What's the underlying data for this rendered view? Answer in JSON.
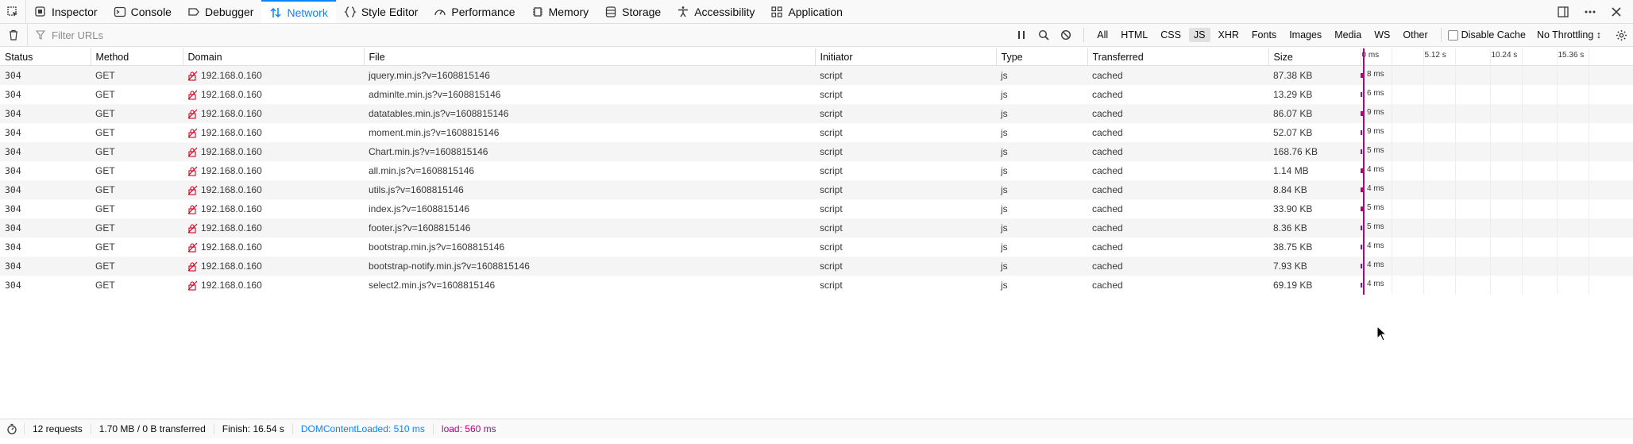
{
  "tabs": [
    {
      "label": "Inspector",
      "icon": "inspector-icon"
    },
    {
      "label": "Console",
      "icon": "console-icon"
    },
    {
      "label": "Debugger",
      "icon": "debugger-icon"
    },
    {
      "label": "Network",
      "icon": "network-icon",
      "selected": true
    },
    {
      "label": "Style Editor",
      "icon": "style-editor-icon"
    },
    {
      "label": "Performance",
      "icon": "performance-icon"
    },
    {
      "label": "Memory",
      "icon": "memory-icon"
    },
    {
      "label": "Storage",
      "icon": "storage-icon"
    },
    {
      "label": "Accessibility",
      "icon": "accessibility-icon"
    },
    {
      "label": "Application",
      "icon": "application-icon"
    }
  ],
  "filter": {
    "placeholder": "Filter URLs"
  },
  "type_filters": [
    "All",
    "HTML",
    "CSS",
    "JS",
    "XHR",
    "Fonts",
    "Images",
    "Media",
    "WS",
    "Other"
  ],
  "selected_type": "JS",
  "disable_cache_label": "Disable Cache",
  "throttling": "No Throttling ↕",
  "columns": [
    "Status",
    "Method",
    "Domain",
    "File",
    "Initiator",
    "Type",
    "Transferred",
    "Size"
  ],
  "waterfall_markers": [
    "0 ms",
    "5.12 s",
    "10.24 s",
    "15.36 s"
  ],
  "rows": [
    {
      "status": "304",
      "method": "GET",
      "domain": "192.168.0.160",
      "file": "jquery.min.js?v=1608815146",
      "initiator": "script",
      "type": "js",
      "transferred": "cached",
      "size": "87.38 KB",
      "time": "8 ms"
    },
    {
      "status": "304",
      "method": "GET",
      "domain": "192.168.0.160",
      "file": "adminlte.min.js?v=1608815146",
      "initiator": "script",
      "type": "js",
      "transferred": "cached",
      "size": "13.29 KB",
      "time": "6 ms"
    },
    {
      "status": "304",
      "method": "GET",
      "domain": "192.168.0.160",
      "file": "datatables.min.js?v=1608815146",
      "initiator": "script",
      "type": "js",
      "transferred": "cached",
      "size": "86.07 KB",
      "time": "9 ms"
    },
    {
      "status": "304",
      "method": "GET",
      "domain": "192.168.0.160",
      "file": "moment.min.js?v=1608815146",
      "initiator": "script",
      "type": "js",
      "transferred": "cached",
      "size": "52.07 KB",
      "time": "9 ms"
    },
    {
      "status": "304",
      "method": "GET",
      "domain": "192.168.0.160",
      "file": "Chart.min.js?v=1608815146",
      "initiator": "script",
      "type": "js",
      "transferred": "cached",
      "size": "168.76 KB",
      "time": "5 ms"
    },
    {
      "status": "304",
      "method": "GET",
      "domain": "192.168.0.160",
      "file": "all.min.js?v=1608815146",
      "initiator": "script",
      "type": "js",
      "transferred": "cached",
      "size": "1.14 MB",
      "time": "4 ms"
    },
    {
      "status": "304",
      "method": "GET",
      "domain": "192.168.0.160",
      "file": "utils.js?v=1608815146",
      "initiator": "script",
      "type": "js",
      "transferred": "cached",
      "size": "8.84 KB",
      "time": "4 ms"
    },
    {
      "status": "304",
      "method": "GET",
      "domain": "192.168.0.160",
      "file": "index.js?v=1608815146",
      "initiator": "script",
      "type": "js",
      "transferred": "cached",
      "size": "33.90 KB",
      "time": "5 ms"
    },
    {
      "status": "304",
      "method": "GET",
      "domain": "192.168.0.160",
      "file": "footer.js?v=1608815146",
      "initiator": "script",
      "type": "js",
      "transferred": "cached",
      "size": "8.36 KB",
      "time": "5 ms"
    },
    {
      "status": "304",
      "method": "GET",
      "domain": "192.168.0.160",
      "file": "bootstrap.min.js?v=1608815146",
      "initiator": "script",
      "type": "js",
      "transferred": "cached",
      "size": "38.75 KB",
      "time": "4 ms"
    },
    {
      "status": "304",
      "method": "GET",
      "domain": "192.168.0.160",
      "file": "bootstrap-notify.min.js?v=1608815146",
      "initiator": "script",
      "type": "js",
      "transferred": "cached",
      "size": "7.93 KB",
      "time": "4 ms"
    },
    {
      "status": "304",
      "method": "GET",
      "domain": "192.168.0.160",
      "file": "select2.min.js?v=1608815146",
      "initiator": "script",
      "type": "js",
      "transferred": "cached",
      "size": "69.19 KB",
      "time": "4 ms"
    }
  ],
  "status": {
    "requests": "12 requests",
    "transferred": "1.70 MB / 0 B transferred",
    "finish": "Finish: 16.54 s",
    "dom_content_loaded": "DOMContentLoaded: 510 ms",
    "load": "load: 560 ms"
  },
  "colors": {
    "accent": "#0a84ff",
    "load": "#b5007f"
  }
}
